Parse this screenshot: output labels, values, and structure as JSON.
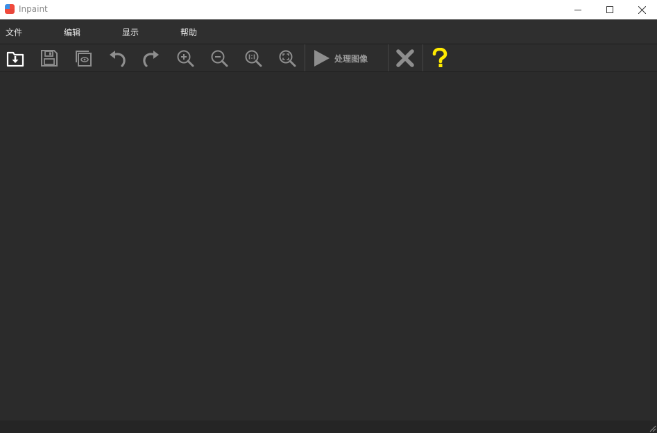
{
  "window": {
    "title": "Inpaint"
  },
  "menu": {
    "file": "文件",
    "edit": "编辑",
    "view": "显示",
    "help": "帮助"
  },
  "toolbar": {
    "process_label": "处理图像",
    "icons": [
      "open-icon",
      "save-icon",
      "preview-icon",
      "undo-icon",
      "redo-icon",
      "zoom-in-icon",
      "zoom-out-icon",
      "actual-size-icon",
      "fit-icon",
      "play-icon",
      "close-icon",
      "help-icon"
    ]
  },
  "colors": {
    "help_icon": "#ffea00",
    "toolbar_icon": "#8e8e8e",
    "open_icon": "#ffffff"
  }
}
